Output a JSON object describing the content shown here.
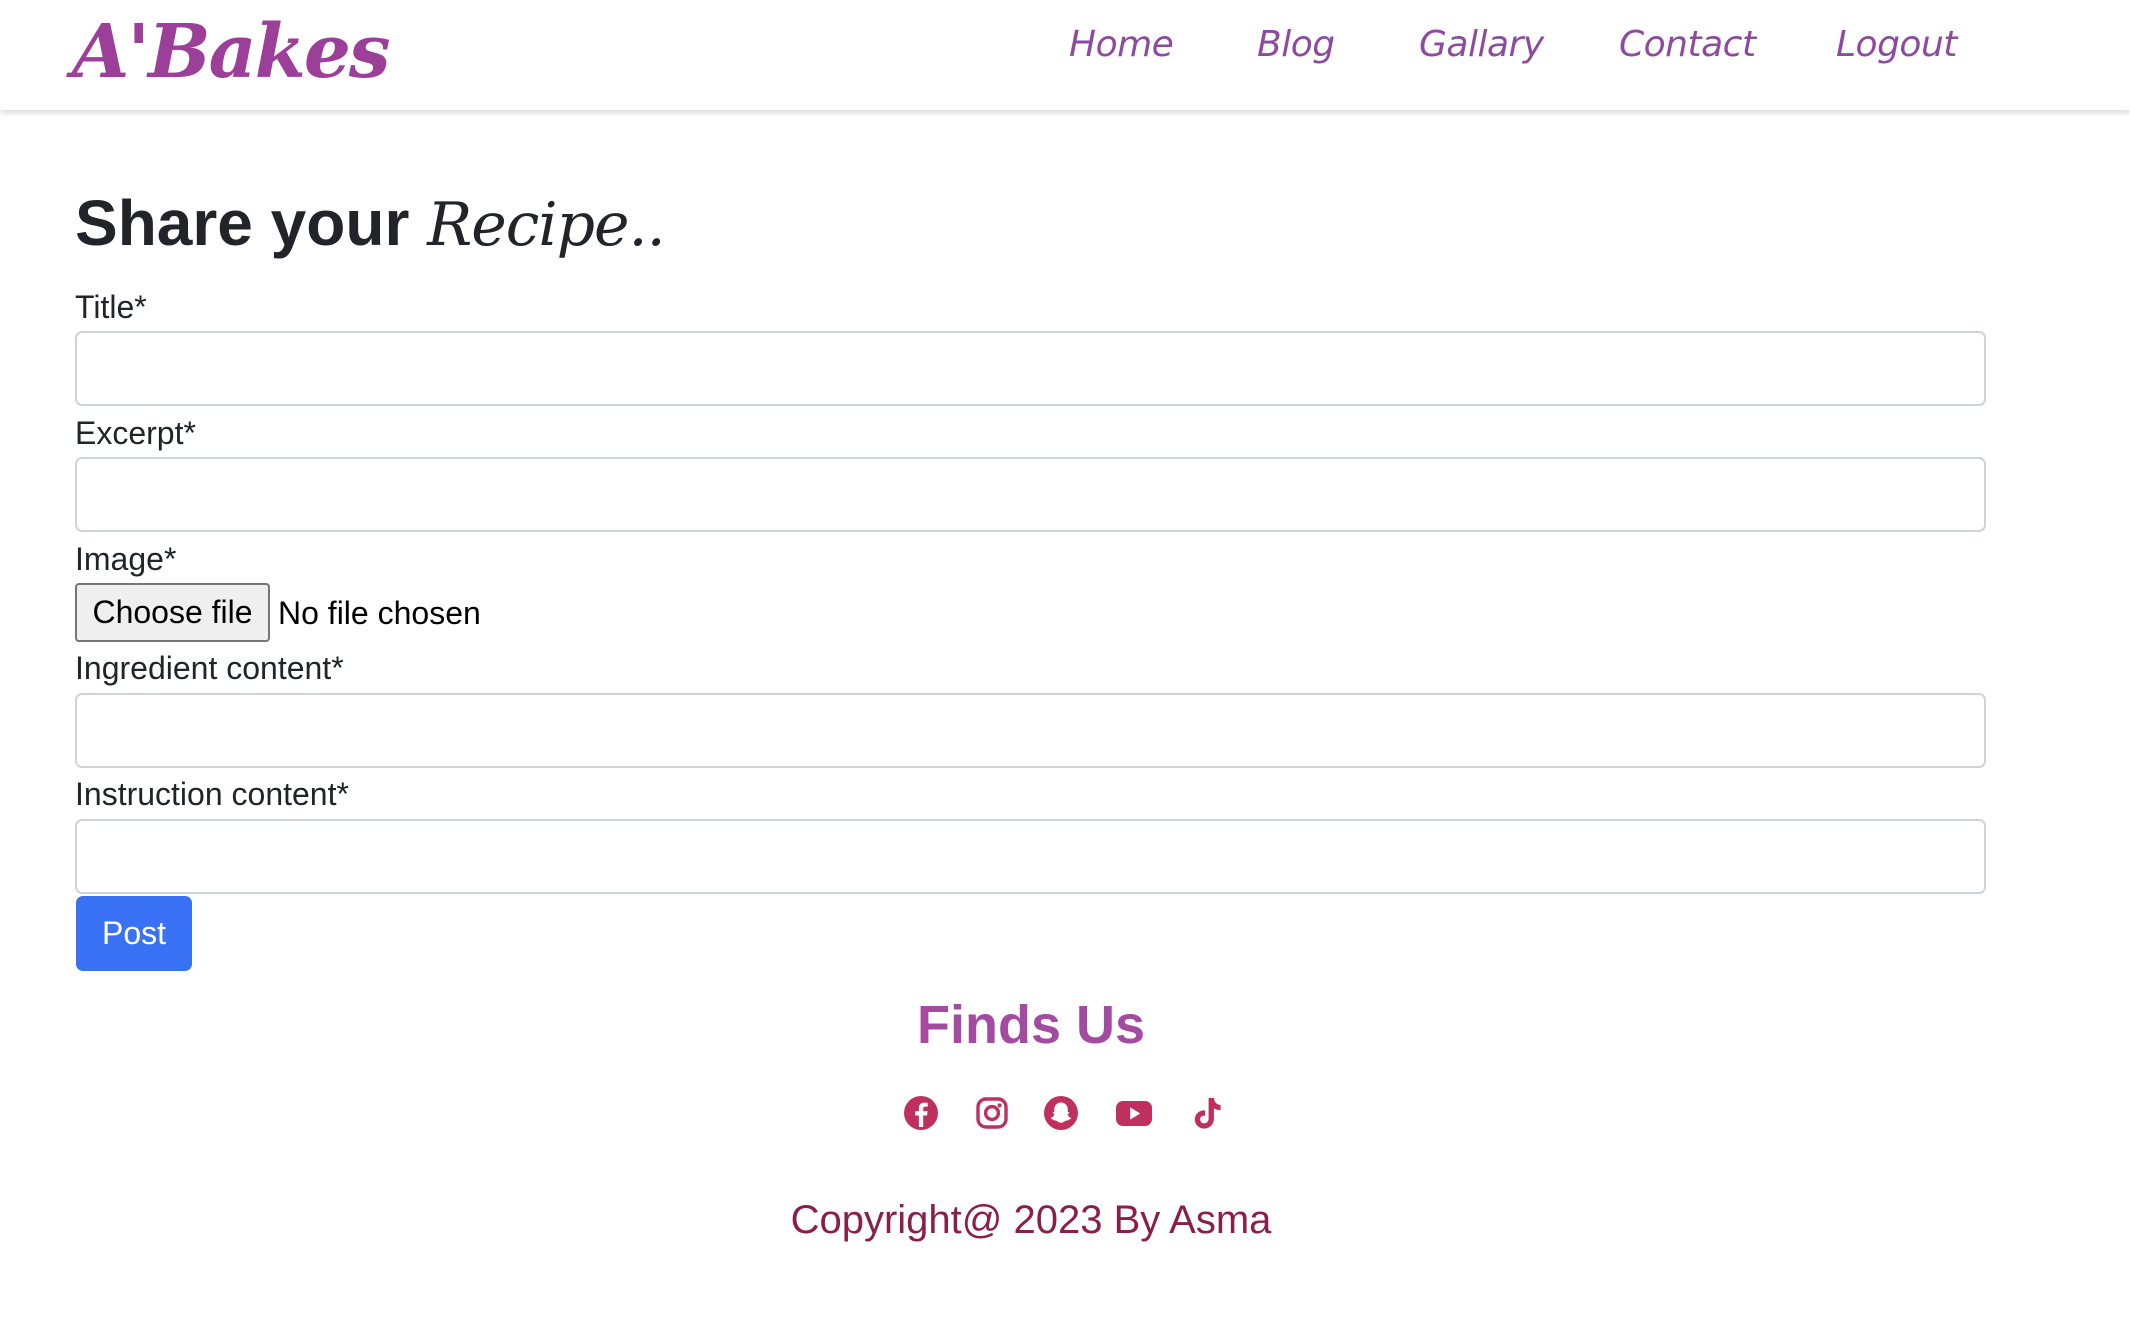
{
  "brand": "A'Bakes",
  "nav": {
    "items": [
      {
        "label": "Home"
      },
      {
        "label": "Blog"
      },
      {
        "label": "Gallary"
      },
      {
        "label": "Contact"
      },
      {
        "label": "Logout"
      }
    ]
  },
  "form": {
    "title_main": "Share your",
    "title_script": "Recipe..",
    "title_label": "Title*",
    "title_value": "",
    "excerpt_label": "Excerpt*",
    "excerpt_value": "",
    "image_label": "Image*",
    "choose_file_label": "Choose file",
    "file_status": "No file chosen",
    "ingredient_label": "Ingredient content*",
    "ingredient_value": "",
    "instruction_label": "Instruction content*",
    "instruction_value": "",
    "post_label": "Post"
  },
  "footer": {
    "title": "Finds Us",
    "social_icons": [
      "facebook-icon",
      "instagram-icon",
      "snapchat-icon",
      "youtube-icon",
      "tiktok-icon"
    ],
    "copyright": "Copyright@ 2023 By Asma"
  },
  "colors": {
    "brand": "#9b3f98",
    "nav_link": "#8e4a9f",
    "primary_button": "#3a72f5",
    "footer_title": "#a34aa1",
    "social_icon": "#c0305e",
    "copyright": "#8a1f4c"
  }
}
